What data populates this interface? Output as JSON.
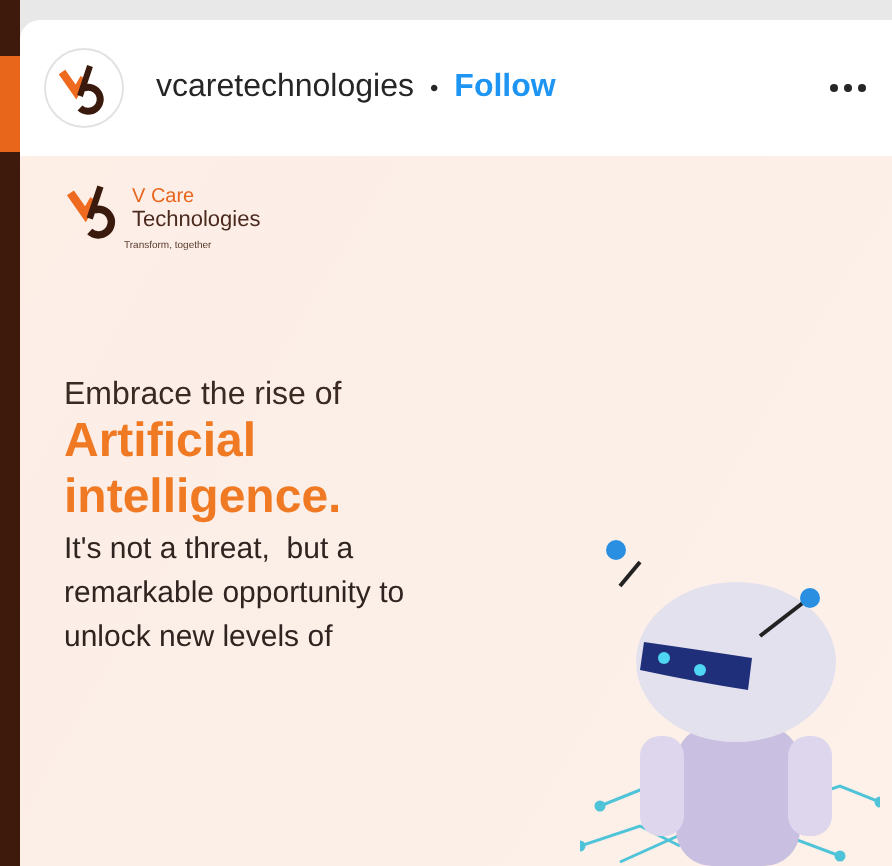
{
  "post": {
    "account": {
      "username": "vcaretechnologies",
      "separator": "•",
      "follow": "Follow"
    },
    "image": {
      "brand_name": "V Care",
      "brand_sub": "Technologies",
      "tagline": "Transform, together",
      "headline": "Embrace the rise of",
      "highlight_lines": [
        "Artificial",
        "intelligence."
      ],
      "body_lines": [
        "It's not a threat,  but a",
        "remarkable opportunity to",
        "unlock new levels of"
      ]
    }
  }
}
